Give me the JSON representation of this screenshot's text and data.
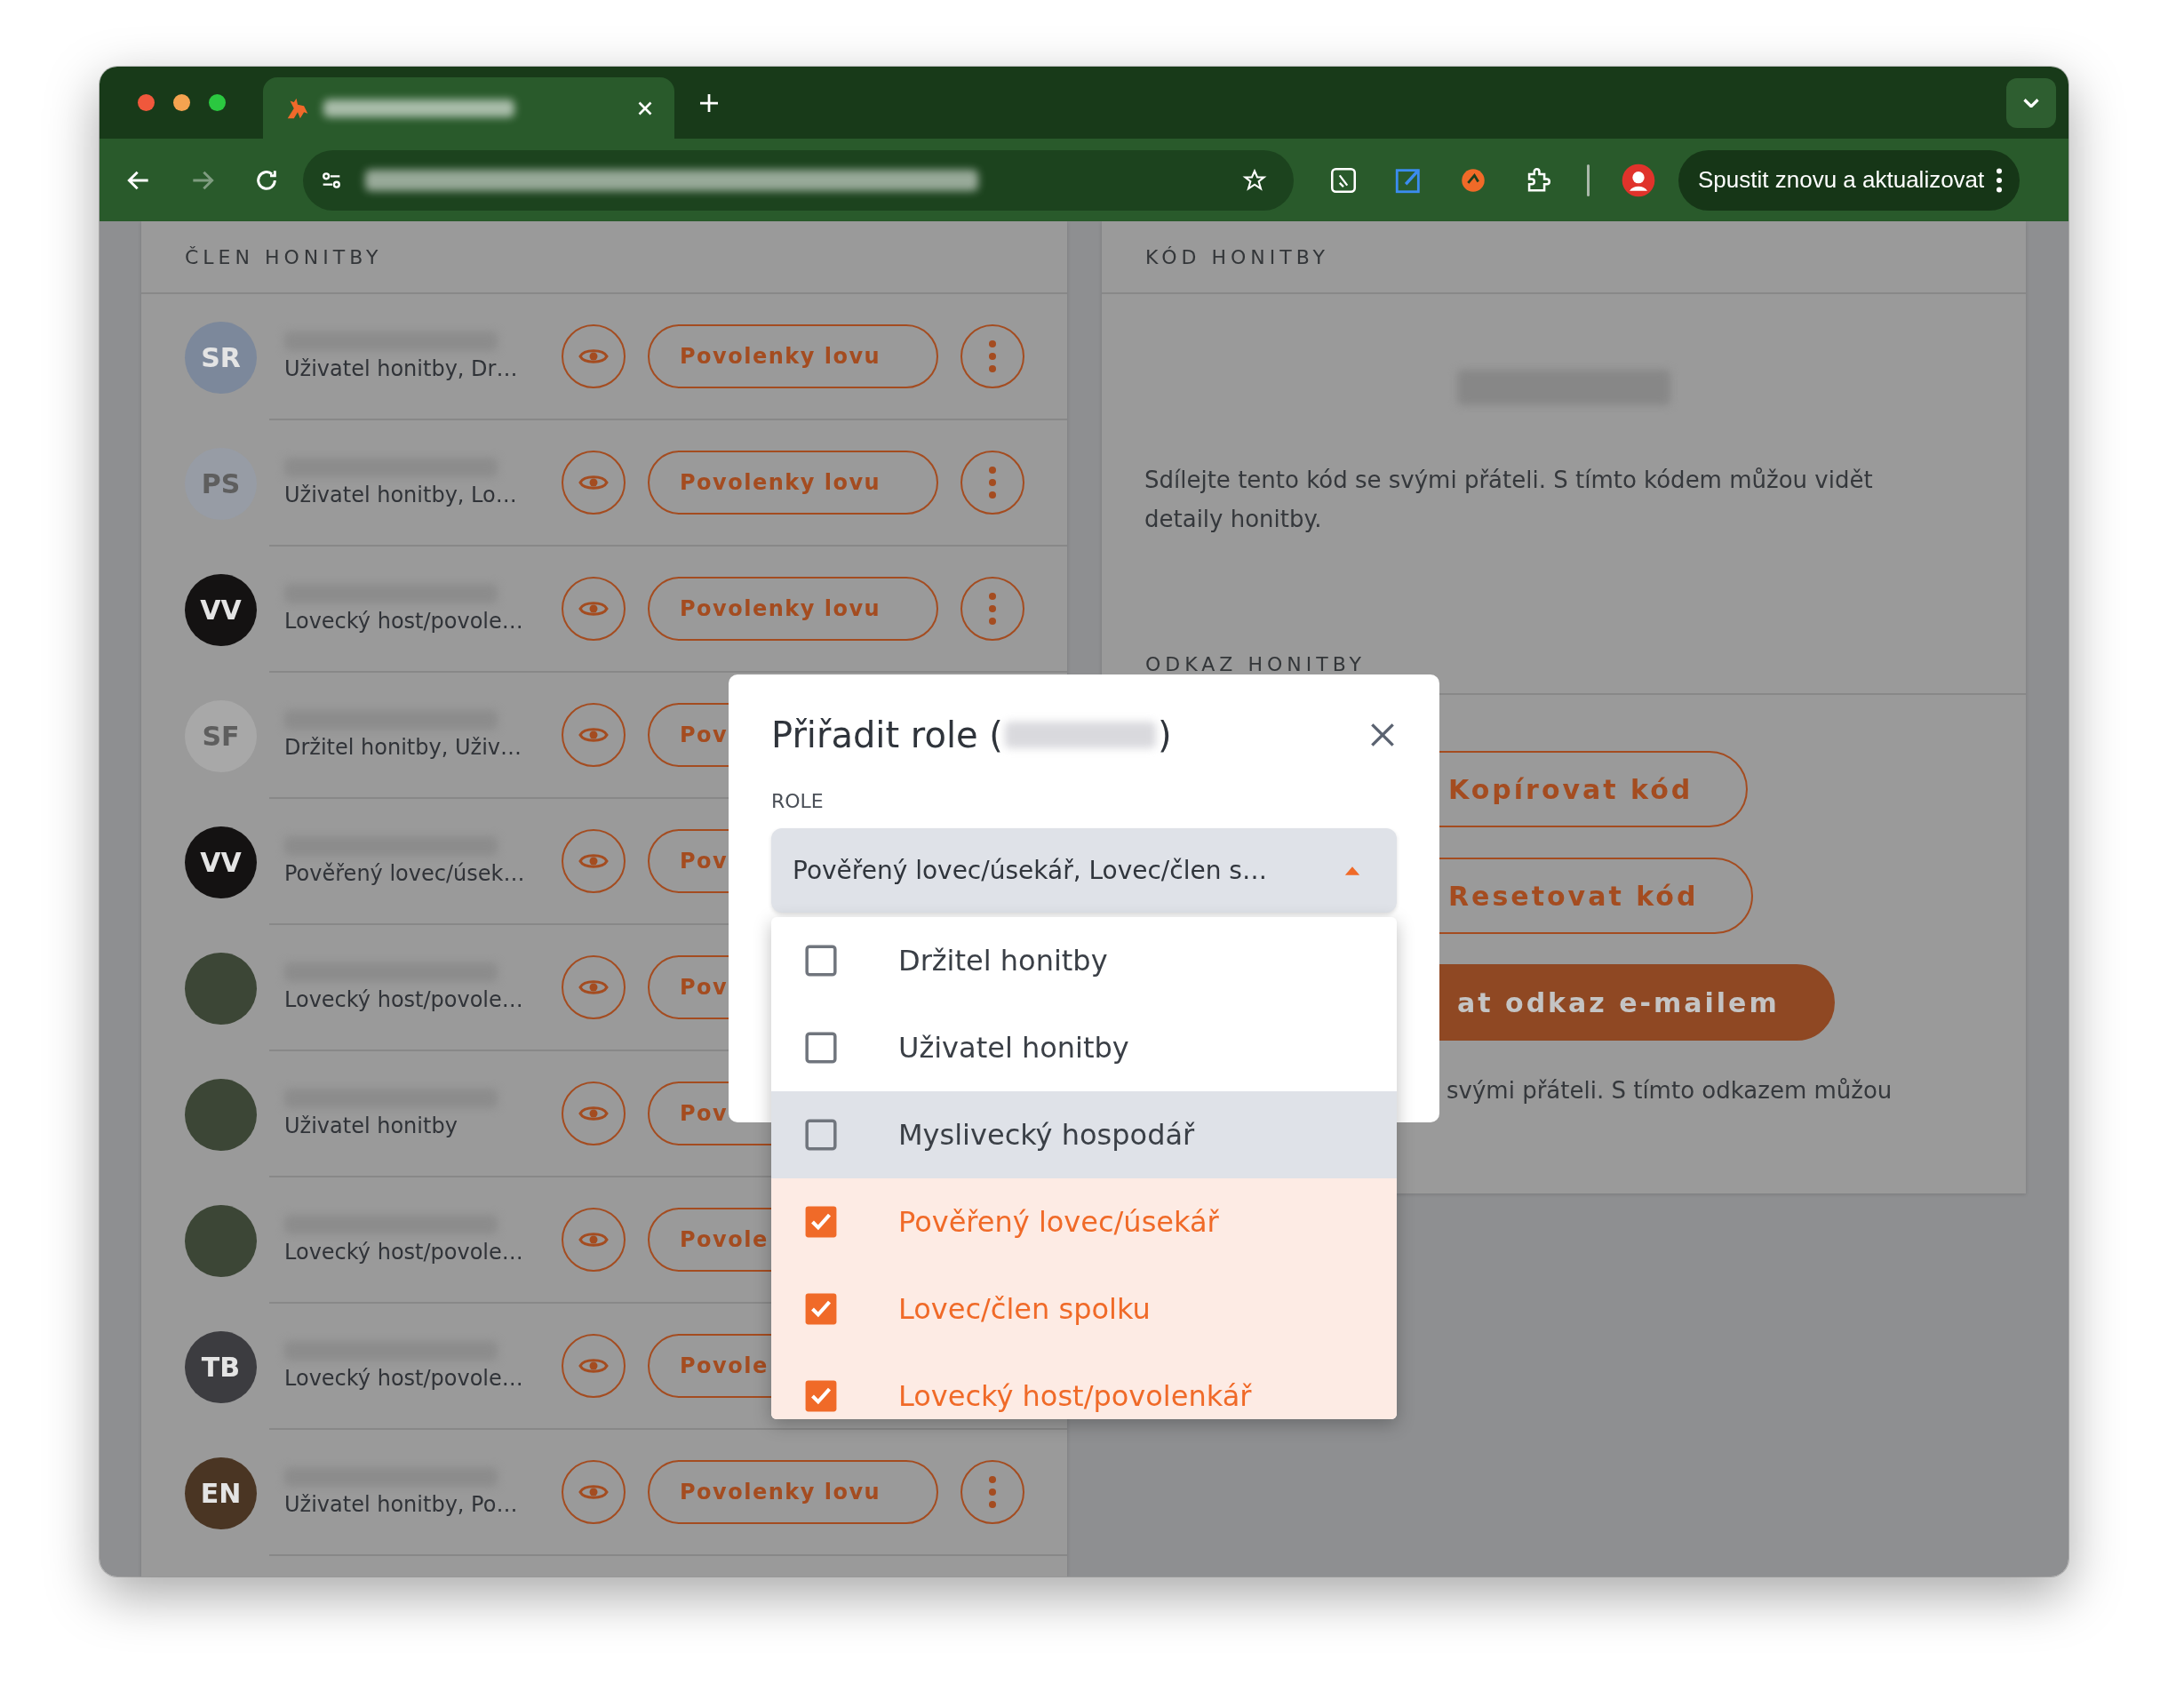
{
  "browser": {
    "forward_disabled": true,
    "update_button": "Spustit znovu a aktualizovat"
  },
  "members": {
    "title": "ČLEN HONITBY",
    "rows": [
      {
        "kind": "initials",
        "initials": "SR",
        "color": "#7c889b",
        "roles": "Uživatel honitby, Dr…",
        "permit_button": "Povolenky lovu",
        "menu_button": true
      },
      {
        "kind": "initials",
        "initials": "PS",
        "color": "#979ca5",
        "roles": "Uživatel honitby, Lo…",
        "permit_button": "Povolenky lovu",
        "menu_button": true
      },
      {
        "kind": "initials",
        "initials": "VV",
        "color": "#141212",
        "roles": "Lovecký host/povole…",
        "permit_button": "Povolenky lovu",
        "menu_button": true
      },
      {
        "kind": "initials",
        "initials": "SF",
        "color": "#a8a8a8",
        "roles": "Držitel honitby, Uživ…",
        "permit_button": "Pov"
      },
      {
        "kind": "initials",
        "initials": "VV",
        "color": "#141212",
        "roles": "Pověřený lovec/úsek…",
        "permit_button": "Pov"
      },
      {
        "kind": "photo",
        "roles": "Lovecký host/povole…",
        "permit_button": "Pov"
      },
      {
        "kind": "photo",
        "roles": "Uživatel honitby",
        "permit_button": "Pov"
      },
      {
        "kind": "photo",
        "roles": "Lovecký host/povole…",
        "permit_button": "Povole"
      },
      {
        "kind": "initials",
        "initials": "TB",
        "color": "#3c3c40",
        "roles": "Lovecký host/povole…",
        "permit_button": "Povole"
      },
      {
        "kind": "initials",
        "initials": "EN",
        "color": "#4a3523",
        "roles": "Uživatel honitby, Po…",
        "permit_button": "Povolenky lovu",
        "menu_button": true
      }
    ]
  },
  "code_card": {
    "title": "KÓD HONITBY",
    "text": "Sdílejte tento kód se svými přáteli. S tímto kódem můžou vidět detaily honitby.",
    "link_title": "ODKAZ HONITBY",
    "buttons": [
      {
        "label": "Kopírovat kód",
        "kind": "outline"
      },
      {
        "label": "Resetovat kód",
        "kind": "outline"
      },
      {
        "label": "at odkaz e-mailem",
        "kind": "filled"
      }
    ],
    "link_text": "svými přáteli. S tímto odkazem můžou"
  },
  "dialog": {
    "title_start": "Přiřadit role (",
    "title_end": ")",
    "field_label": "ROLE",
    "value": "Pověřený lovec/úsekář, Lovec/člen s…",
    "expanded": true,
    "options": [
      {
        "label": "Držitel honitby",
        "checked": false,
        "highlighted": false
      },
      {
        "label": "Uživatel honitby",
        "checked": false,
        "highlighted": false
      },
      {
        "label": "Myslivecký hospodář",
        "checked": false,
        "highlighted": true
      },
      {
        "label": "Pověřený lovec/úsekář",
        "checked": true,
        "highlighted": false
      },
      {
        "label": "Lovec/člen spolku",
        "checked": true,
        "highlighted": false
      },
      {
        "label": "Lovecký host/povolenkář",
        "checked": true,
        "highlighted": false
      }
    ]
  }
}
